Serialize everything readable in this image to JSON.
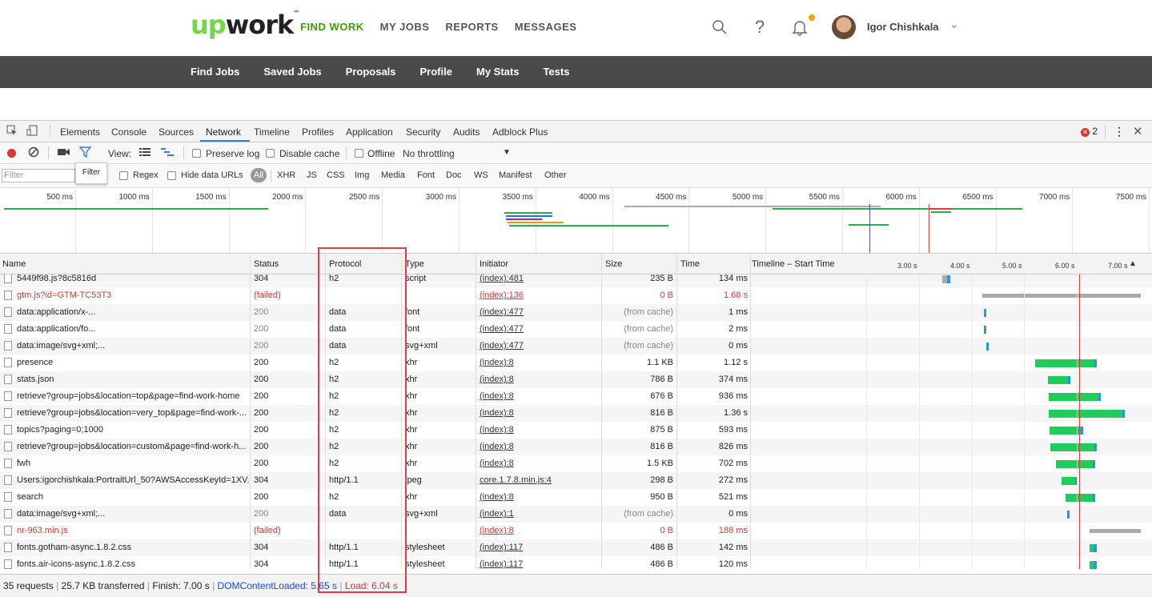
{
  "header": {
    "logo_up": "up",
    "logo_work": "work",
    "logo_tm": "™",
    "nav": [
      "FIND WORK",
      "MY JOBS",
      "REPORTS",
      "MESSAGES"
    ],
    "user_name": "Igor Chishkala"
  },
  "subnav": [
    "Find Jobs",
    "Saved Jobs",
    "Proposals",
    "Profile",
    "My Stats",
    "Tests"
  ],
  "devtools": {
    "tabs": [
      "Elements",
      "Console",
      "Sources",
      "Network",
      "Timeline",
      "Profiles",
      "Application",
      "Security",
      "Audits",
      "Adblock Plus"
    ],
    "active_tab": "Network",
    "error_count": "2",
    "toolbar": {
      "view_label": "View:",
      "preserve_log": "Preserve log",
      "disable_cache": "Disable cache",
      "offline": "Offline",
      "throttling": "No throttling"
    },
    "filter": {
      "placeholder": "Filter",
      "tooltip": "Filter",
      "regex": "Regex",
      "hide_data_urls": "Hide data URLs",
      "types": [
        "All",
        "XHR",
        "JS",
        "CSS",
        "Img",
        "Media",
        "Font",
        "Doc",
        "WS",
        "Manifest",
        "Other"
      ]
    },
    "overview_ticks": [
      "500 ms",
      "1000 ms",
      "1500 ms",
      "2000 ms",
      "2500 ms",
      "3000 ms",
      "3500 ms",
      "4000 ms",
      "4500 ms",
      "5000 ms",
      "5500 ms",
      "6000 ms",
      "6500 ms",
      "7000 ms",
      "7500 ms"
    ],
    "columns": [
      "Name",
      "Status",
      "Protocol",
      "Type",
      "Initiator",
      "Size",
      "Time",
      "Timeline – Start Time"
    ],
    "waterfall_ticks": [
      "3.00 s",
      "4.00 s",
      "5.00 s",
      "6.00 s",
      "7.00 s"
    ],
    "rows": [
      {
        "name": "5449f98.js?8c5816d",
        "status": "304",
        "protocol": "h2",
        "type": "script",
        "initiator": "(index):481",
        "size": "235 B",
        "time": "134 ms",
        "failed": false,
        "muted": false
      },
      {
        "name": "gtm.js?id=GTM-TC53T3",
        "status": "(failed)",
        "protocol": "",
        "type": "",
        "initiator": "(index):136",
        "size": "0 B",
        "time": "1.68 s",
        "failed": true,
        "muted": false
      },
      {
        "name": "data:application/x-...",
        "status": "200",
        "protocol": "data",
        "type": "font",
        "initiator": "(index):477",
        "size": "(from cache)",
        "time": "1 ms",
        "failed": false,
        "muted": true
      },
      {
        "name": "data:application/fo...",
        "status": "200",
        "protocol": "data",
        "type": "font",
        "initiator": "(index):477",
        "size": "(from cache)",
        "time": "2 ms",
        "failed": false,
        "muted": true
      },
      {
        "name": "data:image/svg+xml;...",
        "status": "200",
        "protocol": "data",
        "type": "svg+xml",
        "initiator": "(index):477",
        "size": "(from cache)",
        "time": "0 ms",
        "failed": false,
        "muted": true
      },
      {
        "name": "presence",
        "status": "200",
        "protocol": "h2",
        "type": "xhr",
        "initiator": "(index):8",
        "size": "1.1 KB",
        "time": "1.12 s",
        "failed": false,
        "muted": false
      },
      {
        "name": "stats.json",
        "status": "200",
        "protocol": "h2",
        "type": "xhr",
        "initiator": "(index):8",
        "size": "786 B",
        "time": "374 ms",
        "failed": false,
        "muted": false
      },
      {
        "name": "retrieve?group=jobs&location=top&page=find-work-home",
        "status": "200",
        "protocol": "h2",
        "type": "xhr",
        "initiator": "(index):8",
        "size": "676 B",
        "time": "936 ms",
        "failed": false,
        "muted": false
      },
      {
        "name": "retrieve?group=jobs&location=very_top&page=find-work-...",
        "status": "200",
        "protocol": "h2",
        "type": "xhr",
        "initiator": "(index):8",
        "size": "816 B",
        "time": "1.36 s",
        "failed": false,
        "muted": false
      },
      {
        "name": "topics?paging=0;1000",
        "status": "200",
        "protocol": "h2",
        "type": "xhr",
        "initiator": "(index):8",
        "size": "875 B",
        "time": "593 ms",
        "failed": false,
        "muted": false
      },
      {
        "name": "retrieve?group=jobs&location=custom&page=find-work-h...",
        "status": "200",
        "protocol": "h2",
        "type": "xhr",
        "initiator": "(index):8",
        "size": "816 B",
        "time": "826 ms",
        "failed": false,
        "muted": false
      },
      {
        "name": "fwh",
        "status": "200",
        "protocol": "h2",
        "type": "xhr",
        "initiator": "(index):8",
        "size": "1.5 KB",
        "time": "702 ms",
        "failed": false,
        "muted": false
      },
      {
        "name": "Users:igorchishkala:PortraitUrl_50?AWSAccessKeyId=1XV...",
        "status": "304",
        "protocol": "http/1.1",
        "type": "jpeg",
        "initiator": "core.1.7.8.min.js:4",
        "size": "298 B",
        "time": "272 ms",
        "failed": false,
        "muted": false
      },
      {
        "name": "search",
        "status": "200",
        "protocol": "h2",
        "type": "xhr",
        "initiator": "(index):8",
        "size": "950 B",
        "time": "521 ms",
        "failed": false,
        "muted": false
      },
      {
        "name": "data:image/svg+xml;...",
        "status": "200",
        "protocol": "data",
        "type": "svg+xml",
        "initiator": "(index):1",
        "size": "(from cache)",
        "time": "0 ms",
        "failed": false,
        "muted": true
      },
      {
        "name": "nr-963.min.js",
        "status": "(failed)",
        "protocol": "",
        "type": "",
        "initiator": "(index):8",
        "size": "0 B",
        "time": "188 ms",
        "failed": true,
        "muted": false
      },
      {
        "name": "fonts.gotham-async.1.8.2.css",
        "status": "304",
        "protocol": "http/1.1",
        "type": "stylesheet",
        "initiator": "(index):117",
        "size": "486 B",
        "time": "142 ms",
        "failed": false,
        "muted": false
      },
      {
        "name": "fonts.air-icons-async.1.8.2.css",
        "status": "304",
        "protocol": "http/1.1",
        "type": "stylesheet",
        "initiator": "(index):117",
        "size": "486 B",
        "time": "120 ms",
        "failed": false,
        "muted": false
      }
    ],
    "status": {
      "requests": "35 requests",
      "transferred": "25.7 KB transferred",
      "finish": "Finish: 7.00 s",
      "dom_content_loaded": "DOMContentLoaded: 5.65 s",
      "load": "Load: 6.04 s"
    }
  },
  "colors": {
    "brand_green": "#6fda44",
    "nav_active": "#37a000",
    "failed_red": "#d9362f",
    "highlight": "#e03a4e"
  }
}
